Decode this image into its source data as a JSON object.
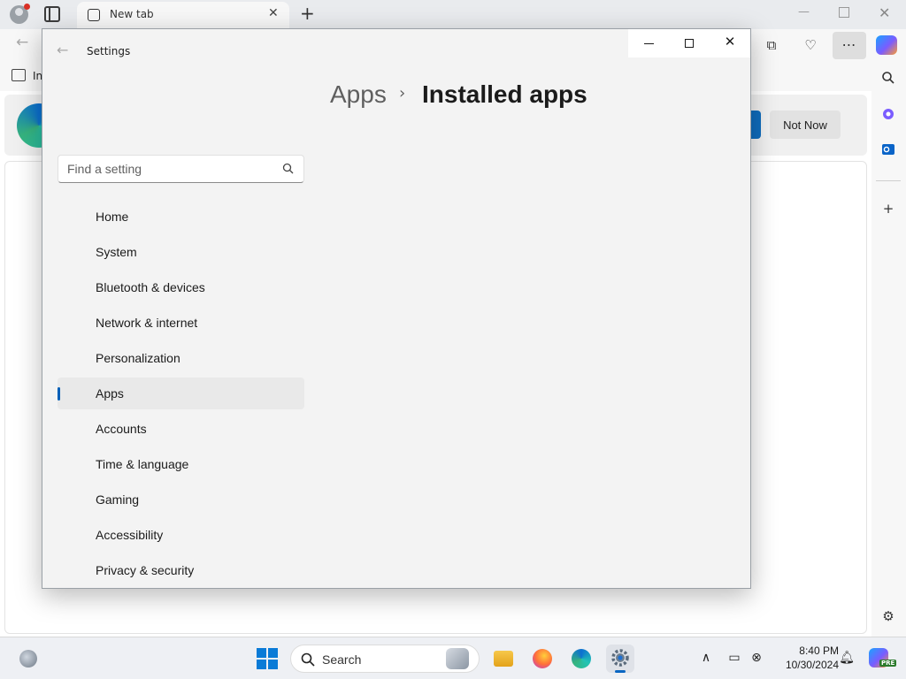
{
  "browser": {
    "tab_title": "New tab",
    "favorites_first_label": "In",
    "banner_secondary_button": "Not Now",
    "toolbar_menu_glyph": "⋯",
    "icons": {
      "back": "back-arrow-icon",
      "collections": "collections-icon",
      "health": "browser-essentials-icon",
      "menu": "more-options-icon",
      "copilot": "copilot-icon",
      "search": "search-icon",
      "sidebar_add": "plus-icon",
      "sidebar_settings": "gear-icon"
    }
  },
  "settings_window": {
    "title": "Settings",
    "breadcrumb": {
      "parent": "Apps",
      "separator": "›",
      "current": "Installed apps"
    },
    "search_placeholder": "Find a setting",
    "nav": [
      {
        "label": "Home",
        "selected": false
      },
      {
        "label": "System",
        "selected": false
      },
      {
        "label": "Bluetooth & devices",
        "selected": false
      },
      {
        "label": "Network & internet",
        "selected": false
      },
      {
        "label": "Personalization",
        "selected": false
      },
      {
        "label": "Apps",
        "selected": true
      },
      {
        "label": "Accounts",
        "selected": false
      },
      {
        "label": "Time & language",
        "selected": false
      },
      {
        "label": "Gaming",
        "selected": false
      },
      {
        "label": "Accessibility",
        "selected": false
      },
      {
        "label": "Privacy & security",
        "selected": false
      }
    ],
    "accent_color": "#005fb8"
  },
  "taskbar": {
    "search_label": "Search",
    "clock_time": "8:40 PM",
    "clock_date": "10/30/2024",
    "copilot_badge": "PRE",
    "tray_chevron": "∧",
    "accent_color": "#0a7bd7"
  }
}
